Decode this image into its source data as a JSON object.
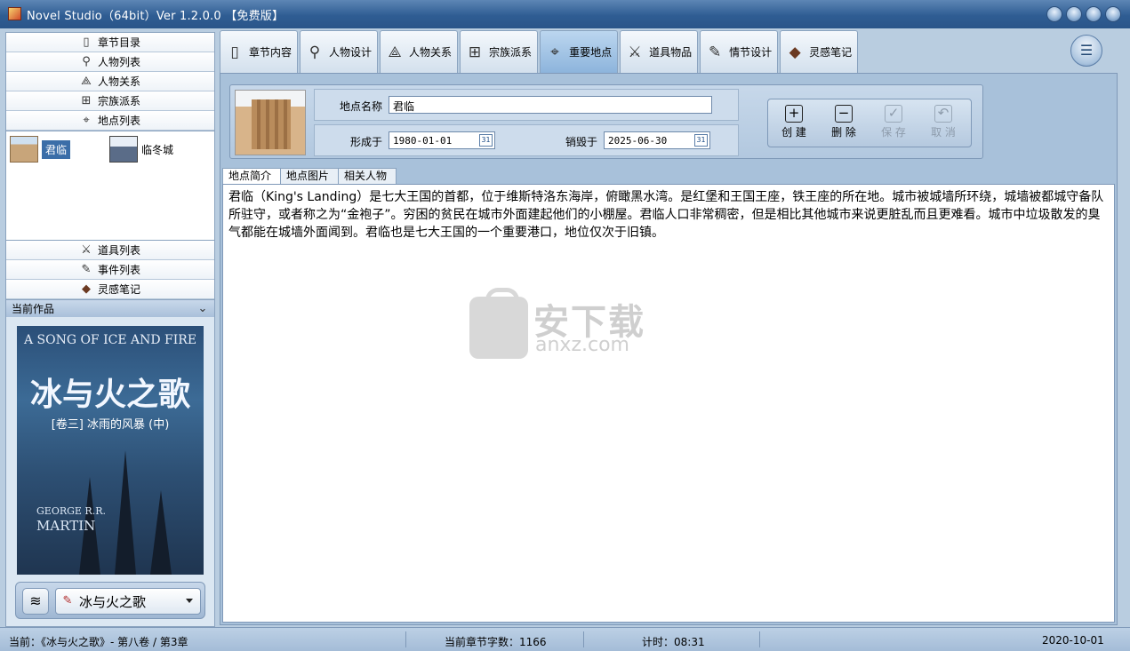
{
  "window": {
    "title": "Novel Studio（64bit）Ver 1.2.0.0 【免费版】"
  },
  "sidebar": {
    "nav_top": [
      {
        "label": "章节目录",
        "icon": "document-icon"
      },
      {
        "label": "人物列表",
        "icon": "person-icon"
      },
      {
        "label": "人物关系",
        "icon": "relation-icon"
      },
      {
        "label": "宗族派系",
        "icon": "hierarchy-icon"
      },
      {
        "label": "地点列表",
        "icon": "location-pin-icon"
      }
    ],
    "locations": [
      {
        "label": "君临",
        "selected": true
      },
      {
        "label": "临冬城",
        "selected": false
      }
    ],
    "nav_bottom": [
      {
        "label": "道具列表",
        "icon": "swords-icon"
      },
      {
        "label": "事件列表",
        "icon": "edit-icon"
      },
      {
        "label": "灵感笔记",
        "icon": "notebook-icon"
      }
    ],
    "current_work_label": "当前作品",
    "cover": {
      "line1": "A SONG OF ICE AND FIRE",
      "line2": "冰与火之歌",
      "line3": "[卷三] 冰雨的风暴 (中)",
      "line4a": "GEORGE R.R.",
      "line4b": "MARTIN"
    },
    "work_selected": "冰与火之歌"
  },
  "tabs": [
    {
      "label": "章节内容",
      "icon": "document-icon",
      "active": false
    },
    {
      "label": "人物设计",
      "icon": "person-icon",
      "active": false
    },
    {
      "label": "人物关系",
      "icon": "relation-icon",
      "active": false
    },
    {
      "label": "宗族派系",
      "icon": "hierarchy-icon",
      "active": false
    },
    {
      "label": "重要地点",
      "icon": "location-pin-icon",
      "active": true
    },
    {
      "label": "道具物品",
      "icon": "swords-icon",
      "active": false
    },
    {
      "label": "情节设计",
      "icon": "edit-icon",
      "active": false
    },
    {
      "label": "灵感笔记",
      "icon": "notebook-icon",
      "active": false
    }
  ],
  "form": {
    "name_label": "地点名称",
    "name_value": "君临",
    "formed_label": "形成于",
    "formed_value": "1980-01-01",
    "destroyed_label": "销毁于",
    "destroyed_value": "2025-06-30",
    "calendar_day": "31"
  },
  "actions": {
    "create": "创 建",
    "delete": "删 除",
    "save": "保 存",
    "cancel": "取 消"
  },
  "subtabs": [
    "地点简介",
    "地点图片",
    "相关人物"
  ],
  "content": "君临（King's Landing）是七大王国的首都，位于维斯特洛东海岸，俯瞰黑水湾。是红堡和王国王座，铁王座的所在地。城市被城墙所环绕，城墙被都城守备队所驻守，或者称之为“金袍子”。穷困的贫民在城市外面建起他们的小棚屋。君临人口非常稠密，但是相比其他城市来说更脏乱而且更难看。城市中垃圾散发的臭气都能在城墙外面闻到。君临也是七大王国的一个重要港口，地位仅次于旧镇。",
  "watermark": {
    "text1": "安下载",
    "text2": "anxz.com"
  },
  "status": {
    "current": "当前：《冰与火之歌》- 第八卷 / 第3章",
    "word_count": "当前章节字数：1166",
    "timer": "计时：08:31",
    "date": "2020-10-01"
  }
}
